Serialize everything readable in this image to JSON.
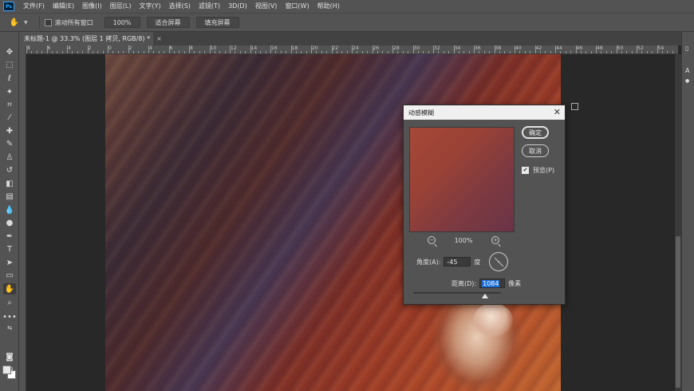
{
  "menubar": {
    "logo": "Ps",
    "items": [
      "文件(F)",
      "编辑(E)",
      "图像(I)",
      "图层(L)",
      "文字(Y)",
      "选择(S)",
      "滤镜(T)",
      "3D(D)",
      "视图(V)",
      "窗口(W)",
      "帮助(H)"
    ]
  },
  "options": {
    "scroll_all_label": "滚动所有窗口",
    "zoom_btn": "100%",
    "fit_btn": "适合屏幕",
    "fill_btn": "填充屏幕"
  },
  "document": {
    "tab_title": "未标题-1 @ 33.3% (图层 1 拷贝, RGB/8) *",
    "close": "×"
  },
  "ruler": {
    "labels": [
      "8",
      "6",
      "4",
      "2",
      "0",
      "2",
      "4",
      "6",
      "8",
      "10",
      "12",
      "14",
      "16",
      "18",
      "20",
      "22",
      "24",
      "26",
      "28",
      "30",
      "32",
      "34",
      "36",
      "38",
      "40",
      "42",
      "44",
      "46",
      "48",
      "50",
      "52",
      "54"
    ]
  },
  "dialog": {
    "title": "动感模糊",
    "close": "✕",
    "ok_label": "确定",
    "cancel_label": "取消",
    "preview_label": "预览(P)",
    "preview_checked": true,
    "zoom_level": "100%",
    "angle_label": "角度(A):",
    "angle_value": "-45",
    "angle_unit": "度",
    "distance_label": "距离(D):",
    "distance_value": "1084",
    "distance_unit": "像素",
    "distance_slider_fraction": 0.82
  },
  "right_panel": {
    "label_a": "A"
  }
}
